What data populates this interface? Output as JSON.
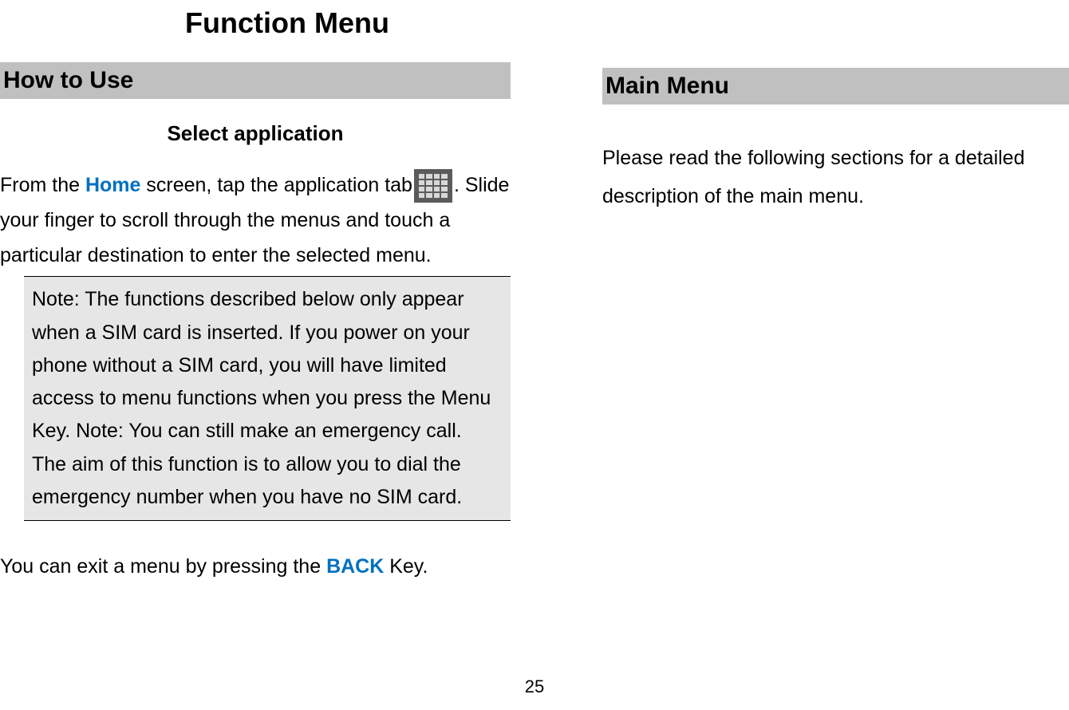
{
  "left": {
    "title": "Function Menu",
    "section_heading": "How to Use",
    "sub_heading": "Select application",
    "para1_pre": "From the ",
    "para1_highlight": "Home",
    "para1_mid": " screen, tap the application tab",
    "para1_post": ". Slide your finger to scroll through the menus and touch a particular destination to enter the selected menu.",
    "note": "Note: The functions described below only appear when a SIM card is inserted. If you power on your phone without a SIM card, you will have limited access to menu functions when you press the Menu Key. Note: You can still make an emergency call. The aim of this function is to allow you to dial the emergency number when you have no SIM card.",
    "para2_pre": "You can exit a menu by pressing the ",
    "para2_highlight": "BACK",
    "para2_post": " Key."
  },
  "right": {
    "section_heading": "Main Menu",
    "body": "Please read the following sections for a detailed description of the main menu."
  },
  "page_number": "25"
}
